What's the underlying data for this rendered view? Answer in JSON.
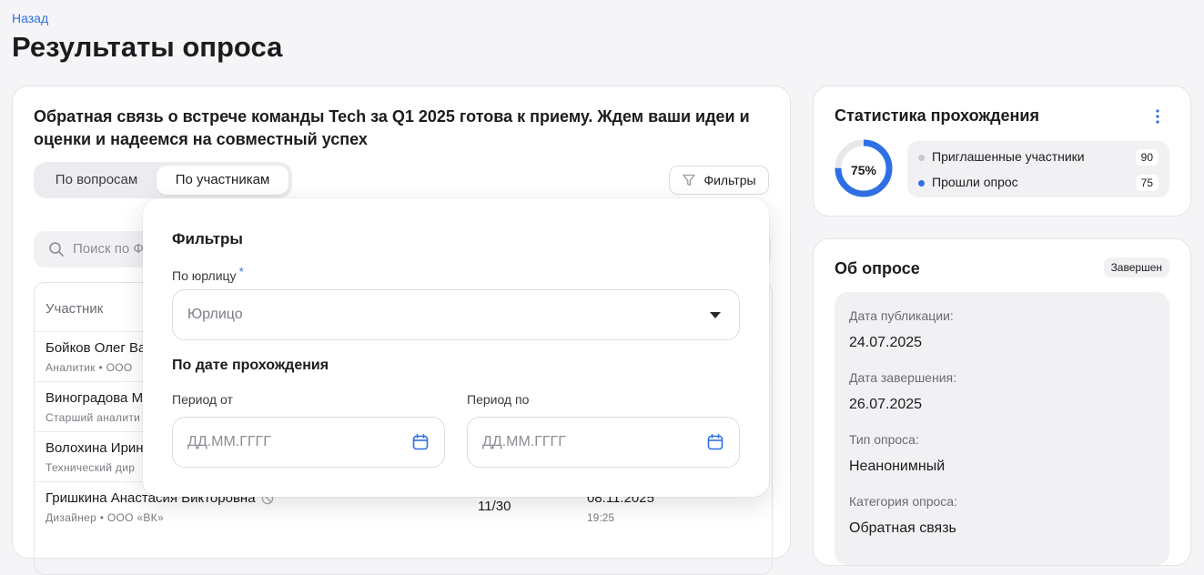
{
  "nav": {
    "back_label": "Назад"
  },
  "page": {
    "title": "Результаты опроса"
  },
  "survey": {
    "title": "Обратная связь о встрече команды Tech за Q1 2025 готова к приему. Ждем ваши идеи и оценки и надеемся на совместный успех",
    "tabs": [
      {
        "label": "По вопросам",
        "active": false
      },
      {
        "label": "По участникам",
        "active": true
      }
    ],
    "filters_button_label": "Фильтры",
    "search_placeholder": "Поиск по Ф"
  },
  "table": {
    "header": "Участник",
    "rows": [
      {
        "name": "Бойков Олег Ва",
        "sub": "Аналитик  •  ООО"
      },
      {
        "name": "Виноградова Ма",
        "sub": "Старший аналити"
      },
      {
        "name": "Волохина Ирина",
        "sub": "Технический дир"
      },
      {
        "name": "Гришкина Анастасия Викторовна",
        "sub": "Дизайнер  •  ООО «ВК»",
        "score": "11/30",
        "date": "08.11.2025",
        "time": "19:25"
      }
    ]
  },
  "filters_popover": {
    "title": "Фильтры",
    "legal_entity_label": "По юрлицу",
    "required_mark": "*",
    "legal_entity_value": "Юрлицо",
    "date_section_title": "По дате прохождения",
    "period_from_label": "Период от",
    "period_to_label": "Период по",
    "date_placeholder": "ДД.ММ.ГГГГ"
  },
  "stats": {
    "title": "Статистика прохождения",
    "percent_label": "75%",
    "percent_value": 75,
    "legend": [
      {
        "label": "Приглашенные участники",
        "count": "90",
        "color": "#c8c8ce"
      },
      {
        "label": "Прошли опрос",
        "count": "75",
        "color": "#2f6fe4"
      }
    ],
    "accent_color": "#2f6fe4"
  },
  "about": {
    "title": "Об опросе",
    "status_badge": "Завершен",
    "fields": [
      {
        "key": "Дата публикации:",
        "value": "24.07.2025"
      },
      {
        "key": "Дата завершения:",
        "value": "26.07.2025"
      },
      {
        "key": "Тип опроса:",
        "value": "Неанонимный"
      },
      {
        "key": "Категория опроса:",
        "value": "Обратная связь"
      }
    ]
  }
}
